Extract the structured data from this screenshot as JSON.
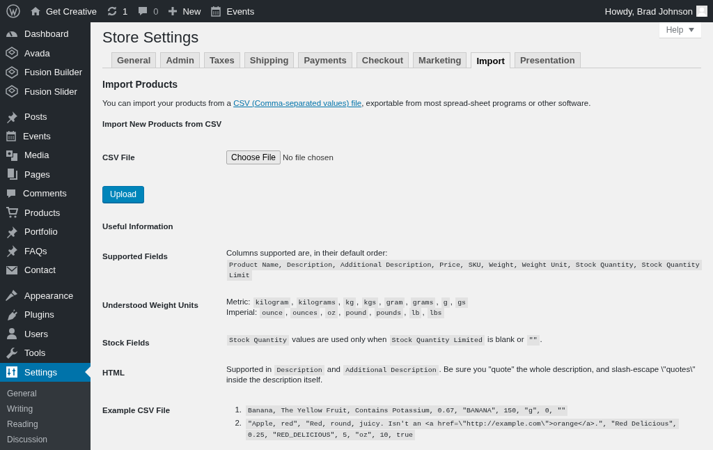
{
  "admin_bar": {
    "items": [
      {
        "label": "Get Creative"
      },
      {
        "label": "1"
      },
      {
        "label": "0"
      },
      {
        "label": "New"
      },
      {
        "label": "Events"
      }
    ],
    "account": "Howdy, Brad Johnson"
  },
  "sidebar": {
    "groups": [
      [
        {
          "label": "Dashboard",
          "selected": false
        },
        {
          "label": "Avada",
          "selected": false
        },
        {
          "label": "Fusion Builder",
          "selected": false
        },
        {
          "label": "Fusion Slider",
          "selected": false
        }
      ],
      [
        {
          "label": "Posts",
          "selected": false
        },
        {
          "label": "Events",
          "selected": false
        },
        {
          "label": "Media",
          "selected": false
        },
        {
          "label": "Pages",
          "selected": false
        },
        {
          "label": "Comments",
          "selected": false
        },
        {
          "label": "Products",
          "selected": false
        },
        {
          "label": "Portfolio",
          "selected": false
        },
        {
          "label": "FAQs",
          "selected": false
        },
        {
          "label": "Contact",
          "selected": false
        }
      ],
      [
        {
          "label": "Appearance",
          "selected": false
        },
        {
          "label": "Plugins",
          "selected": false
        },
        {
          "label": "Users",
          "selected": false
        },
        {
          "label": "Tools",
          "selected": false
        },
        {
          "label": "Settings",
          "selected": true
        }
      ]
    ],
    "submenu": [
      {
        "label": "General",
        "selected": false
      },
      {
        "label": "Writing",
        "selected": false
      },
      {
        "label": "Reading",
        "selected": false
      },
      {
        "label": "Discussion",
        "selected": false
      }
    ]
  },
  "help": {
    "label": "Help"
  },
  "page": {
    "title": "Store Settings",
    "tabs": [
      {
        "label": "General",
        "selected": false
      },
      {
        "label": "Admin",
        "selected": false
      },
      {
        "label": "Taxes",
        "selected": false
      },
      {
        "label": "Shipping",
        "selected": false
      },
      {
        "label": "Payments",
        "selected": false
      },
      {
        "label": "Checkout",
        "selected": false
      },
      {
        "label": "Marketing",
        "selected": false
      },
      {
        "label": "Import",
        "selected": true
      },
      {
        "label": "Presentation",
        "selected": false
      }
    ],
    "heading": "Import Products",
    "intro": {
      "before": "You can import your products from a ",
      "link": "CSV (Comma-separated values) file",
      "after": ", exportable from most spread-sheet programs or other software."
    },
    "import_heading": "Import New Products from CSV",
    "csv_file": {
      "label": "CSV File",
      "button": "Choose File",
      "status": "No file chosen"
    },
    "upload_button": "Upload",
    "info_heading": "Useful Information",
    "info_rows": [
      {
        "kind": "lines",
        "label": "Supported Fields",
        "lines": [
          [
            {
              "kind": "text",
              "text": "Columns supported are, in their default order:"
            }
          ],
          [
            {
              "kind": "code",
              "text": "Product Name, Description, Additional Description, Price, SKU, Weight, Weight Unit, Stock Quantity, Stock Quantity Limit"
            }
          ]
        ]
      },
      {
        "kind": "lines",
        "label": "Understood Weight Units",
        "lines": [
          [
            {
              "kind": "text",
              "text": "Metric: "
            },
            {
              "kind": "code",
              "text": "kilogram"
            },
            {
              "kind": "text",
              "text": ", "
            },
            {
              "kind": "code",
              "text": "kilograms"
            },
            {
              "kind": "text",
              "text": ", "
            },
            {
              "kind": "code",
              "text": "kg"
            },
            {
              "kind": "text",
              "text": ", "
            },
            {
              "kind": "code",
              "text": "kgs"
            },
            {
              "kind": "text",
              "text": ", "
            },
            {
              "kind": "code",
              "text": "gram"
            },
            {
              "kind": "text",
              "text": ", "
            },
            {
              "kind": "code",
              "text": "grams"
            },
            {
              "kind": "text",
              "text": ", "
            },
            {
              "kind": "code",
              "text": "g"
            },
            {
              "kind": "text",
              "text": ", "
            },
            {
              "kind": "code",
              "text": "gs"
            }
          ],
          [
            {
              "kind": "text",
              "text": "Imperial: "
            },
            {
              "kind": "code",
              "text": "ounce"
            },
            {
              "kind": "text",
              "text": ", "
            },
            {
              "kind": "code",
              "text": "ounces"
            },
            {
              "kind": "text",
              "text": ", "
            },
            {
              "kind": "code",
              "text": "oz"
            },
            {
              "kind": "text",
              "text": ", "
            },
            {
              "kind": "code",
              "text": "pound"
            },
            {
              "kind": "text",
              "text": ", "
            },
            {
              "kind": "code",
              "text": "pounds"
            },
            {
              "kind": "text",
              "text": ", "
            },
            {
              "kind": "code",
              "text": "lb"
            },
            {
              "kind": "text",
              "text": ", "
            },
            {
              "kind": "code",
              "text": "lbs"
            }
          ]
        ]
      },
      {
        "kind": "lines",
        "label": "Stock Fields",
        "lines": [
          [
            {
              "kind": "code",
              "text": "Stock Quantity"
            },
            {
              "kind": "text",
              "text": " values are used only when "
            },
            {
              "kind": "code",
              "text": "Stock Quantity Limited"
            },
            {
              "kind": "text",
              "text": " is blank or "
            },
            {
              "kind": "code",
              "text": "\"\""
            },
            {
              "kind": "text",
              "text": "."
            }
          ]
        ]
      },
      {
        "kind": "lines",
        "label": "HTML",
        "lines": [
          [
            {
              "kind": "text",
              "text": "Supported in "
            },
            {
              "kind": "code",
              "text": "Description"
            },
            {
              "kind": "text",
              "text": " and "
            },
            {
              "kind": "code",
              "text": "Additional Description"
            },
            {
              "kind": "text",
              "text": ". Be sure you \"quote\" the whole description, and slash-escape \\\"quotes\\\" inside the description itself."
            }
          ]
        ]
      },
      {
        "kind": "list",
        "label": "Example CSV File",
        "items": [
          {
            "number": "1.",
            "code": "Banana, The Yellow Fruit, Contains Potassium, 0.67, \"BANANA\", 150, \"g\", 0, \"\""
          },
          {
            "number": "2.",
            "code": "\"Apple, red\", \"Red, round, juicy. Isn't an <a href=\\\"http://example.com\\\">orange</a>.\", \"Red Delicious\", 0.25, \"RED_DELICIOUS\", 5, \"oz\", 10, true"
          }
        ]
      }
    ]
  }
}
